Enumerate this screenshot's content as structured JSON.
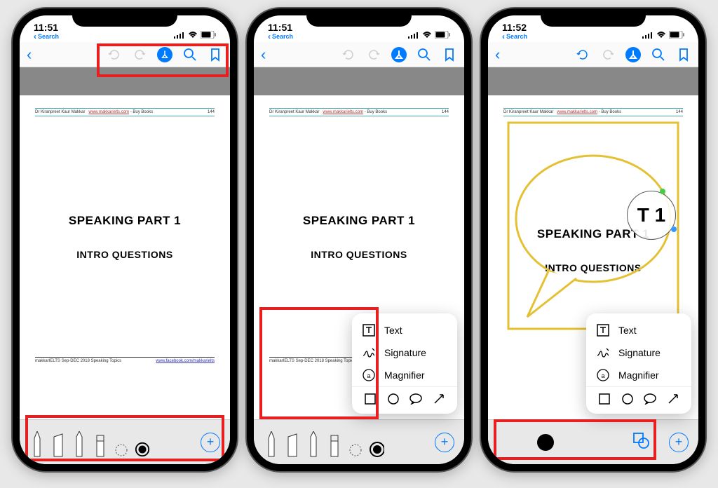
{
  "status": {
    "time1": "11:51",
    "time2": "11:51",
    "time3": "11:52",
    "search_label": "Search"
  },
  "doc": {
    "header_author": "Dr Kiranpreet Kaur Makkar",
    "header_link": "www.makkarielts.com",
    "header_tail": " - Buy Books",
    "header_page": "144",
    "title": "SPEAKING PART 1",
    "subtitle": "INTRO QUESTIONS",
    "footer_left": "makkarIELTS Sep-DEC 2018 Speaking Topics",
    "footer_link": "www.facebook.com/makkarielts"
  },
  "popup": {
    "text": "Text",
    "signature": "Signature",
    "magnifier": "Magnifier"
  },
  "magnifier_content": "T 1"
}
